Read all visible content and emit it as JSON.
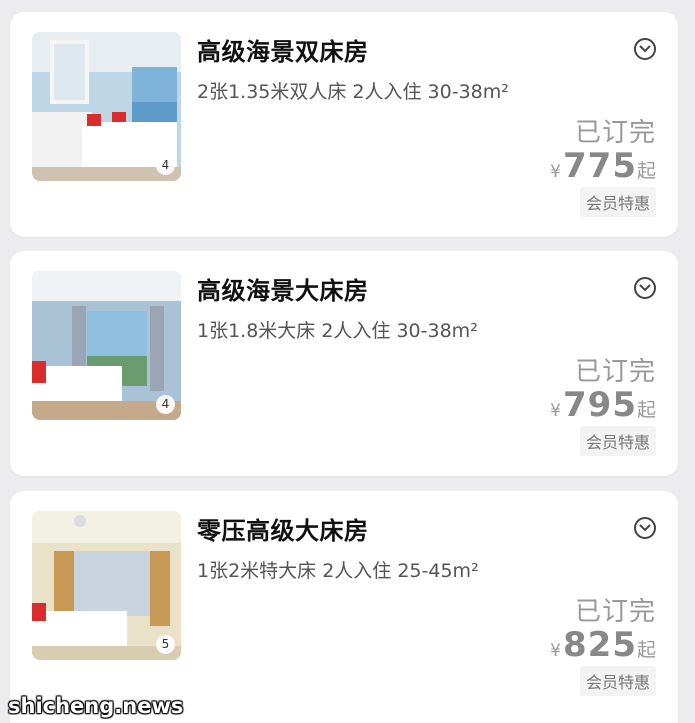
{
  "rooms": [
    {
      "title": "高级海景双床房",
      "desc": "2张1.35米双人床  2人入住  30-38m²",
      "status": "已订完",
      "currency": "¥",
      "price": "775",
      "price_suffix": "起",
      "badge": "会员特惠",
      "photo_count": "4"
    },
    {
      "title": "高级海景大床房",
      "desc": "1张1.8米大床  2人入住  30-38m²",
      "status": "已订完",
      "currency": "¥",
      "price": "795",
      "price_suffix": "起",
      "badge": "会员特惠",
      "photo_count": "4"
    },
    {
      "title": "零压高级大床房",
      "desc": "1张2米特大床  2人入住  25-45m²",
      "status": "已订完",
      "currency": "¥",
      "price": "825",
      "price_suffix": "起",
      "badge": "会员特惠",
      "photo_count": "5"
    }
  ],
  "icons": {
    "expand": "chevron-down-circle-icon"
  },
  "watermark": "shicheng.news"
}
